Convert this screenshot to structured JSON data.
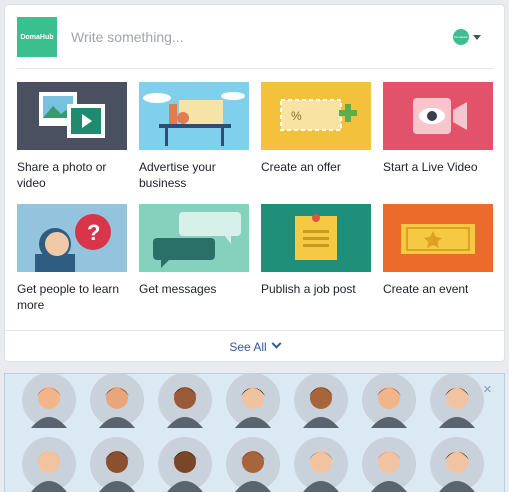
{
  "composer": {
    "logo_text": "DomaHub",
    "placeholder": "Write something...",
    "audience_avatar_text": "DomaHub"
  },
  "actions": [
    {
      "label": "Share a photo or video",
      "icon": "photo-icon"
    },
    {
      "label": "Advertise your business",
      "icon": "storefront-icon"
    },
    {
      "label": "Create an offer",
      "icon": "offer-ticket-icon"
    },
    {
      "label": "Start a Live Video",
      "icon": "live-video-icon"
    },
    {
      "label": "Get people to learn more",
      "icon": "question-icon"
    },
    {
      "label": "Get messages",
      "icon": "messages-icon"
    },
    {
      "label": "Publish a job post",
      "icon": "job-post-icon"
    },
    {
      "label": "Create an event",
      "icon": "event-ticket-icon"
    }
  ],
  "see_all": {
    "label": "See All"
  },
  "people_panel": {
    "close_glyph": "×",
    "faces": [
      {
        "icon": "person-red-hair-icon"
      },
      {
        "icon": "person-brown-hair-icon"
      },
      {
        "icon": "person-dark-skin-icon"
      },
      {
        "icon": "person-black-hair-icon"
      },
      {
        "icon": "person-curly-hair-icon"
      },
      {
        "icon": "person-bob-hair-icon"
      },
      {
        "icon": "person-bun-hair-icon"
      },
      {
        "icon": "person-blonde-hair-icon"
      },
      {
        "icon": "person-short-hair-icon"
      },
      {
        "icon": "person-dark-hair-icon"
      },
      {
        "icon": "person-bald-icon"
      },
      {
        "icon": "person-gray-hair-icon"
      },
      {
        "icon": "person-pink-hair-icon"
      },
      {
        "icon": "person-dark-brown-hair-icon"
      }
    ]
  },
  "colors": {
    "brand": "#3bbf8f",
    "link": "#365899",
    "panel_bg": "#dbe9f3"
  }
}
